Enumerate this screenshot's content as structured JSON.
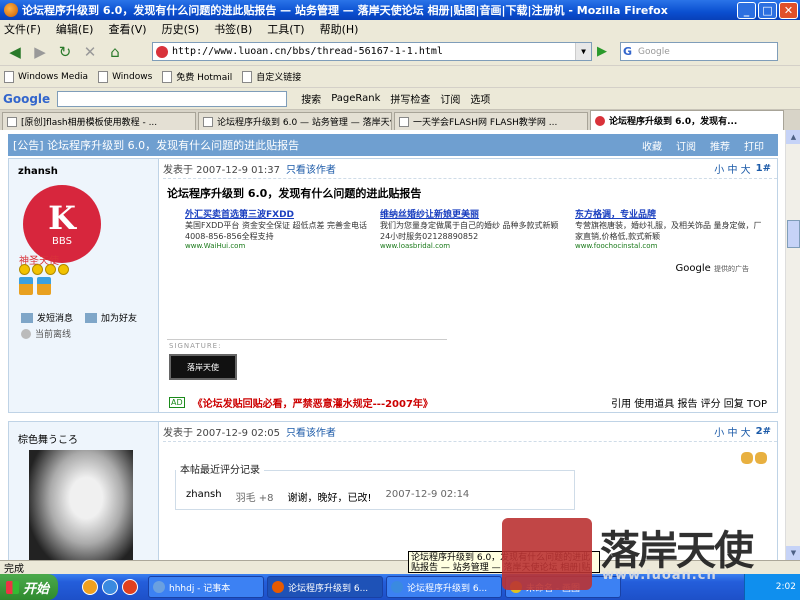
{
  "window": {
    "title": "论坛程序升级到 6.0，发现有什么问题的进此贴报告 — 站务管理 — 落岸天使论坛 相册|贴图|音画|下载|注册机 - Mozilla Firefox",
    "min": "_",
    "max": "□",
    "close": "✕"
  },
  "menu": [
    "文件(F)",
    "编辑(E)",
    "查看(V)",
    "历史(S)",
    "书签(B)",
    "工具(T)",
    "帮助(H)"
  ],
  "nav": {
    "url": "http://www.luoan.cn/bbs/thread-56167-1-1.html",
    "search_placeholder": "Google",
    "search_engine": "G"
  },
  "bookmarks": [
    "Windows Media",
    "Windows",
    "免费 Hotmail",
    "自定义链接"
  ],
  "google_toolbar": {
    "logo": "Google",
    "items": [
      "搜索",
      "PageRank",
      "拼写检查",
      "订阅",
      "选项"
    ]
  },
  "tabs": [
    {
      "label": "[原创]flash相册模板使用教程 - ..."
    },
    {
      "label": "论坛程序升级到 6.0 — 站务管理 — 落岸天使论坛 ..."
    },
    {
      "label": "一天学会FLASH网 FLASH教学网 ..."
    },
    {
      "label": "论坛程序升级到 6.0，发现有..."
    }
  ],
  "thread": {
    "header": "[公告] 论坛程序升级到 6.0，发现有什么问题的进此贴报告",
    "actions": [
      "收藏",
      "订阅",
      "推荐",
      "打印"
    ]
  },
  "post1": {
    "author": "zhansh",
    "avatar_text": "BBS",
    "rank": "神圣天使",
    "send_msg": "发短消息",
    "add_friend": "加为好友",
    "status": "当前离线",
    "posted": "发表于 2007-12-9 01:37",
    "only_author": "只看该作者",
    "font_size": "小 中 大",
    "floor": "1#",
    "title": "论坛程序升级到 6.0，发现有什么问题的进此贴报告",
    "ads": [
      {
        "title": "外汇买卖首选第三波FXDD",
        "desc": "美国FXDD平台 资金安全保证 超低点差 完善金电话4008-856-856全程支持",
        "url": "www.WaiHui.com"
      },
      {
        "title": "维纳丝婚纱让新娘更美丽",
        "desc": "我们为您量身定做属于自己的婚纱 品种多款式新颖24小时服务02128890852",
        "url": "www.loasbridal.com"
      },
      {
        "title": "东方格调，专业品牌",
        "desc": "专营旗袍唐装，婚纱礼服，及相关饰品 量身定做，厂家直销,价格低,款式新颖",
        "url": "www.foochocinstal.com"
      }
    ],
    "google_ads": "Google",
    "google_ads_sub": "提供的广告",
    "signature_label": "SIGNATURE:",
    "signature_img": "落岸天使",
    "notice_tag": "AD",
    "notice": "《论坛发贴回贴必看，严禁恶意灌水规定---2007年》",
    "actions": "引用 使用道具 报告 评分 回复 TOP"
  },
  "post2": {
    "author": "棕色舞うころ",
    "posted": "发表于 2007-12-9 02:05",
    "only_author": "只看该作者",
    "font_size": "小 中 大",
    "floor": "2#",
    "rate_title": "本帖最近评分记录",
    "rate": {
      "user": "zhansh",
      "score": "羽毛 +8",
      "comment": "谢谢，晚好，已改!",
      "time": "2007-12-9 02:14"
    }
  },
  "status": "完成",
  "tooltip": "论坛程序升级到 6.0，发现有什么问题的进此贴报告 — 站务管理 — 落岸天使论坛 相册|贴图|音画|下载|注册机 - Microsoft Inter",
  "taskbar": {
    "start": "开始",
    "tasks": [
      "hhhdj - 记事本",
      "论坛程序升级到 6...",
      "论坛程序升级到 6...",
      "未命名 - 画图"
    ],
    "clock": "2:02"
  },
  "watermark": {
    "text": "落岸天使",
    "url": "www.luoan.cn"
  }
}
